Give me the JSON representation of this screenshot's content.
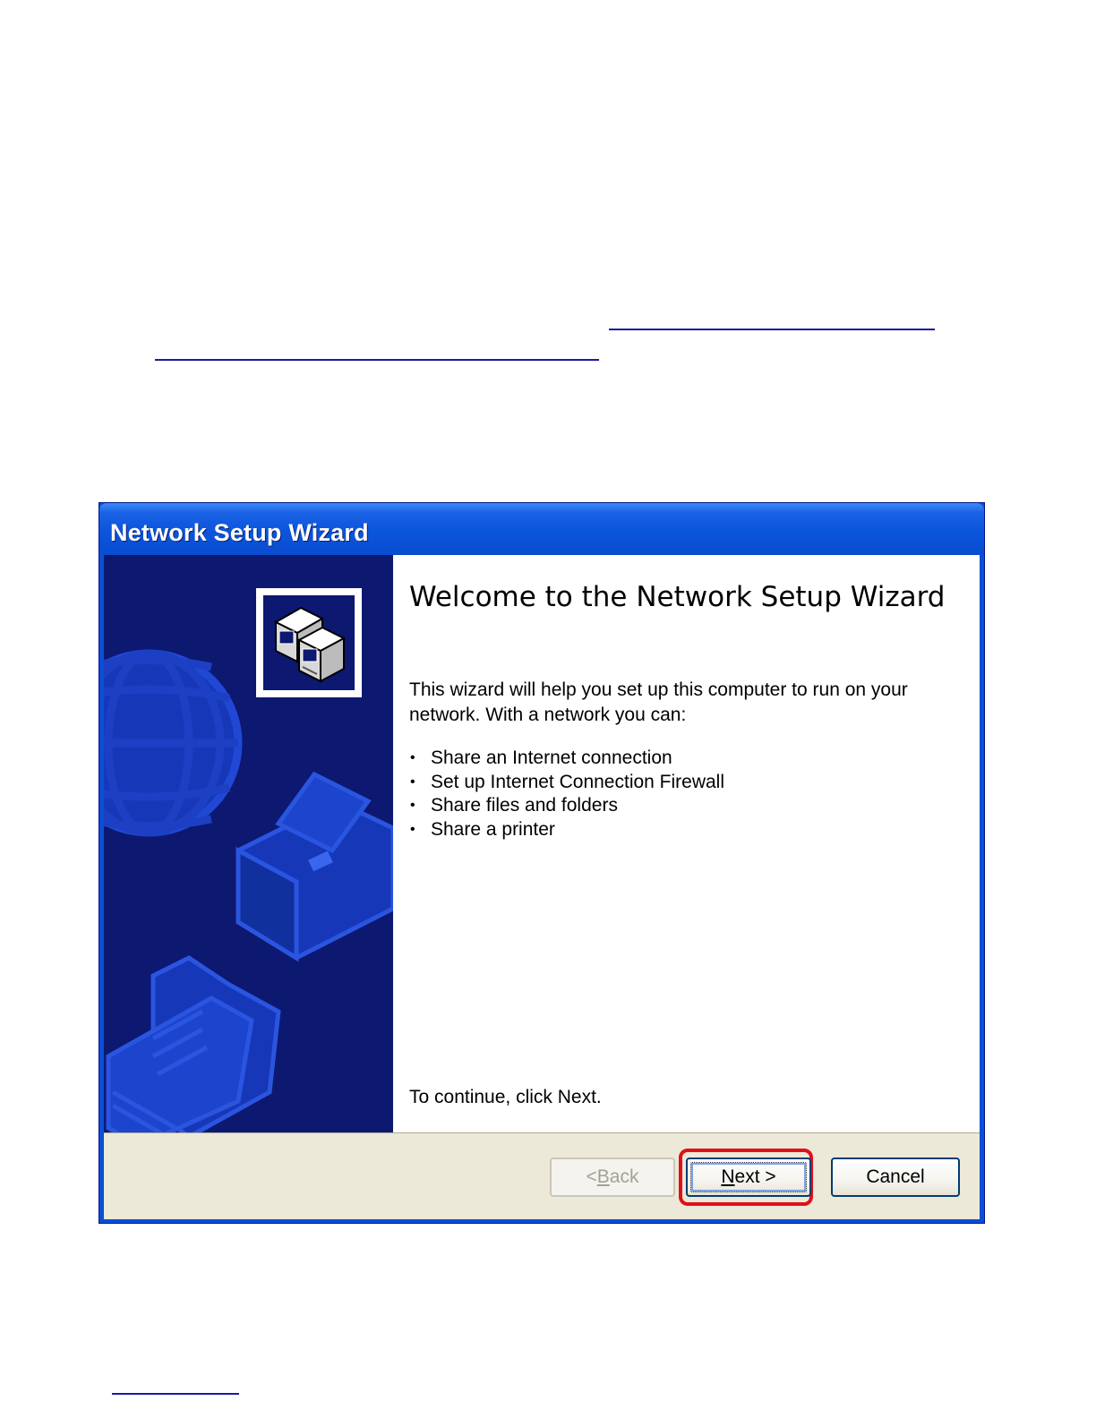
{
  "window": {
    "title": "Network Setup Wizard"
  },
  "content": {
    "heading": "Welcome to the Network Setup Wizard",
    "intro": "This wizard will help you set up this computer to run on your network. With a network you can:",
    "bullets": [
      "Share an Internet connection",
      "Set up Internet Connection Firewall",
      "Share files and folders",
      "Share a printer"
    ],
    "bullet_glyph": "•",
    "continue_text": "To continue, click Next."
  },
  "buttons": {
    "back_prefix": "< ",
    "back_accel": "B",
    "back_rest": "ack",
    "next_accel": "N",
    "next_rest": "ext >",
    "cancel": "Cancel"
  },
  "icons": {
    "wizard": "networked-computers-icon",
    "side_art": [
      "globe",
      "printer",
      "folder-with-documents"
    ]
  },
  "colors": {
    "titlebar": "#0b55dc",
    "side_panel": "#0d1870",
    "button_strip": "#ece9d8",
    "highlight": "#e0101a"
  }
}
